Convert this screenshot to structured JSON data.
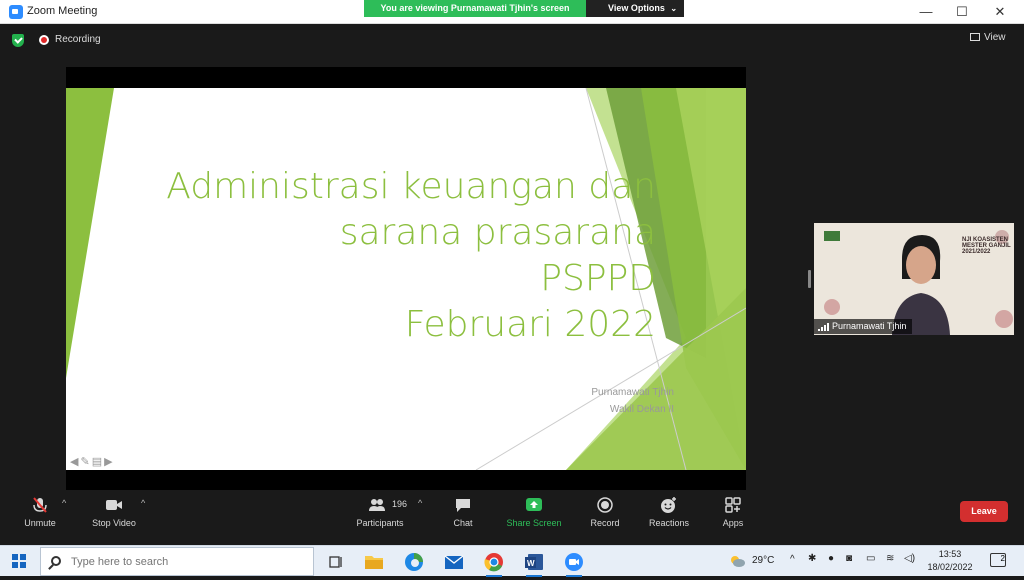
{
  "window": {
    "title": "Zoom Meeting",
    "viewing_banner": "You are viewing Purnamawati Tjhin's screen",
    "view_options": "View Options",
    "minimize": "—",
    "maximize": "☐",
    "close": "✕"
  },
  "meeting_header": {
    "recording_label": "Recording",
    "view_label": "View"
  },
  "slide": {
    "title_lines": [
      "Administrasi keuangan dan",
      "sarana prasarana",
      "PSPPD",
      "Februari 2022"
    ],
    "author": "Purnamawati Tjhin",
    "position": "Wakil Dekan II",
    "accent_color": "#8cbf3f"
  },
  "participant": {
    "name": "Purnamawati Tjhin",
    "banner_line1": "NJI KOASISTEN",
    "banner_line2": "MESTER GANJIL 2021/2022"
  },
  "toolbar": {
    "unmute": "Unmute",
    "stop_video": "Stop Video",
    "participants": "Participants",
    "participants_count": "196",
    "chat": "Chat",
    "share_screen": "Share Screen",
    "record": "Record",
    "reactions": "Reactions",
    "apps": "Apps",
    "leave": "Leave"
  },
  "taskbar": {
    "search_placeholder": "Type here to search",
    "temperature": "29°C",
    "time": "13:53",
    "date": "18/02/2022",
    "notification_count": "2",
    "apps": [
      "task-view",
      "file-explorer",
      "edge",
      "mail",
      "chrome",
      "word",
      "zoom"
    ]
  }
}
